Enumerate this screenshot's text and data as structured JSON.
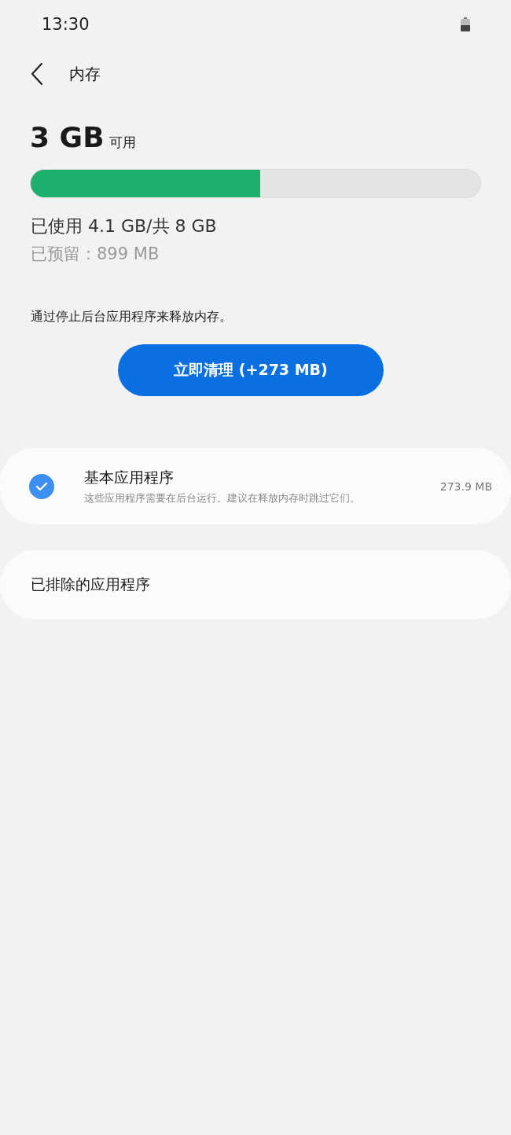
{
  "status_bar": {
    "time": "13:30"
  },
  "header": {
    "title": "内存"
  },
  "memory": {
    "available": "3 GB",
    "available_label": "可用",
    "level": 0.51,
    "used": "已使用 4.1 GB/共 8 GB",
    "reserved": "已预留：899 MB"
  },
  "cleanup": {
    "description": "通过停止后台应用程序来释放内存。",
    "button": "立即清理 (+273 MB)"
  },
  "app_groups": [
    {
      "kind": "checkable",
      "title": "基本应用程序",
      "subtitle": "这些应用程序需要在后台运行。建议在释放内存时跳过它们。",
      "size": "273.9 MB",
      "checked": true
    },
    {
      "kind": "link",
      "title": "已排除的应用程序"
    }
  ]
}
